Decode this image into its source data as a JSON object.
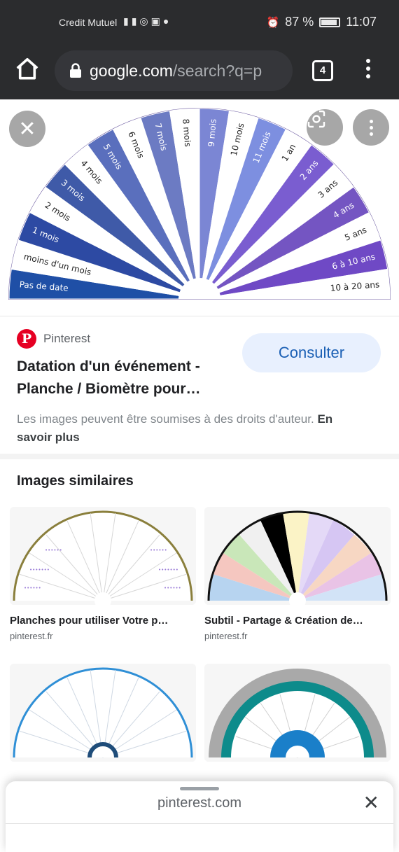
{
  "status_bar": {
    "carrier": "Credit Mutuel",
    "network": "4G",
    "battery": "87 %",
    "time": "11:07"
  },
  "browser": {
    "url_domain": "google.com",
    "url_path": "/search?q=p",
    "tab_count": "4"
  },
  "hero": {
    "wheel_labels": [
      "Pas de date",
      "moins d'un mois",
      "1 mois",
      "2 mois",
      "3 mois",
      "4 mois",
      "5 mois",
      "6 mois",
      "7 mois",
      "8 mois",
      "9 mois",
      "10 mois",
      "11 mois",
      "1 an",
      "2 ans",
      "3 ans",
      "4 ans",
      "5 ans",
      "6 à 10 ans",
      "10 à 20 ans"
    ],
    "wheel_colors": [
      "#1f4fa6",
      "#ffffff",
      "#2d4aa3",
      "#ffffff",
      "#3f5aa8",
      "#ffffff",
      "#5a6fbd",
      "#ffffff",
      "#6c7bc3",
      "#ffffff",
      "#7b86d4",
      "#ffffff",
      "#7d8fe0",
      "#ffffff",
      "#7a5dd0",
      "#ffffff",
      "#7455c2",
      "#ffffff",
      "#6f49c5",
      "#ffffff"
    ],
    "label_colors": [
      "#ffffff",
      "#222222",
      "#ffffff",
      "#222222",
      "#ffffff",
      "#222222",
      "#ffffff",
      "#222222",
      "#ffffff",
      "#222222",
      "#ffffff",
      "#222222",
      "#ffffff",
      "#222222",
      "#ffffff",
      "#222222",
      "#ffffff",
      "#222222",
      "#ffffff",
      "#222222"
    ]
  },
  "result": {
    "source": "Pinterest",
    "consult_label": "Consulter",
    "title": "Datation d'un événement - Planche / Biomètre pour…",
    "rights_text": "Les images peuvent être soumises à des droits d'auteur.",
    "learn_more": "En savoir plus"
  },
  "similar": {
    "heading": "Images similaires",
    "items": [
      {
        "caption": "Planches pour utiliser Votre p…",
        "domain": "pinterest.fr"
      },
      {
        "caption": "Subtil - Partage & Création de…",
        "domain": "pinterest.fr"
      },
      {
        "caption": "",
        "domain": ""
      },
      {
        "caption": "",
        "domain": ""
      }
    ]
  },
  "bottom_sheet": {
    "domain": "pinterest.com"
  }
}
